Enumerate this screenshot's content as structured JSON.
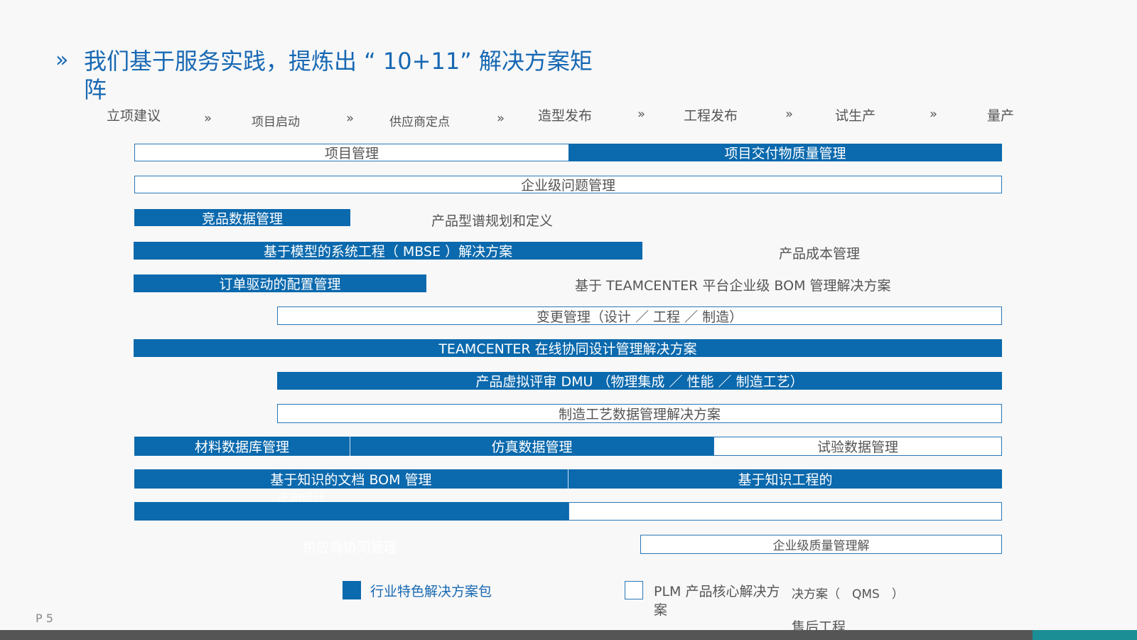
{
  "title": {
    "mark": "»",
    "text": "我们基于服务实践，提炼出 “ 10+11” 解决方案矩阵"
  },
  "phases": [
    {
      "label": "立项建议"
    },
    {
      "label": "项目启动"
    },
    {
      "label": "供应商定点"
    },
    {
      "label": "造型发布"
    },
    {
      "label": "工程发布"
    },
    {
      "label": "试生产"
    },
    {
      "label": "量产"
    }
  ],
  "phase_separator": "»",
  "bars": {
    "project_mgmt": "项目管理",
    "deliverable_quality": "项目交付物质量管理",
    "enterprise_issue": "企业级问题管理",
    "competitor_data": "竞品数据管理",
    "product_lineup": "产品型谱规划和定义",
    "mbse": "基于模型的系统工程（ MBSE ）解决方案",
    "product_cost": "产品成本管理",
    "order_config": "订单驱动的配置管理",
    "teamcenter_bom": "基于 TEAMCENTER 平台企业级 BOM 管理解决方案",
    "change_mgmt": "变更管理（设计 ／ 工程 ／ 制造）",
    "teamcenter_collab": "TEAMCENTER 在线协同设计管理解决方案",
    "dmu": "产品虚拟评审 DMU （物理集成 ／ 性能 ／ 制造工艺）",
    "mfg_process_data": "制造工艺数据管理解决方案",
    "material_db": "材料数据库管理",
    "simulation_data": "仿真数据管理",
    "test_data": "试验数据管理",
    "knowledge_doc_bom": "基于知识的文档 BOM 管理",
    "knowledge_engineering": "基于知识工程的",
    "knowledge_engineering_cont": "正向设计",
    "supplier_collab": "供应商协同管理",
    "enterprise_quality": "企业级质量管理解",
    "qms_suffix": "决方案（　QMS　）",
    "after_sales": "售后工程"
  },
  "legend": {
    "industry": "行业特色解决方案包",
    "plm_core_line1": "PLM 产品核心解决方",
    "plm_core_line2": "案"
  },
  "page_number": "P 5",
  "colors": {
    "accent": "#0b69ad",
    "title": "#1768b3",
    "footer": "#555555",
    "footer_accent": "#1b8d95"
  }
}
